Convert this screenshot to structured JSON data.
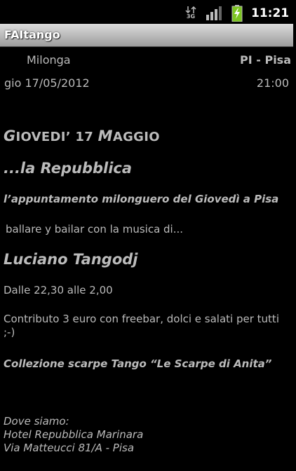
{
  "status_bar": {
    "network_label": "3G",
    "time": "11:21",
    "icons": [
      "network-3g-icon",
      "signal-icon",
      "battery-charging-icon"
    ],
    "battery_color": "#7cc520"
  },
  "app": {
    "title": "FAItango"
  },
  "event_info": {
    "category": "Milonga",
    "place": "PI - Pisa",
    "date": "gio 17/05/2012",
    "time": "21:00"
  },
  "description": {
    "day_title_first_letter": "G",
    "day_title_rest": "IOVEDI’ 17 ",
    "day_title_month_letter": "M",
    "day_title_month_rest": "AGGIO",
    "heading": "...la Repubblica",
    "subtitle": "l’appuntamento milonguero del Giovedì a Pisa",
    "intro": "ballare y bailar con la musica di...",
    "dj": "Luciano Tangodj",
    "hours": "Dalle 22,30 alle 2,00",
    "contribution": "Contributo 3 euro con freebar, dolci e salati per tutti ;-)",
    "collection": "Collezione scarpe Tango “Le Scarpe di Anita”",
    "address_lines": [
      "Dove siamo:",
      "Hotel Repubblica Marinara",
      "Via Matteucci 81/A - Pisa"
    ]
  }
}
